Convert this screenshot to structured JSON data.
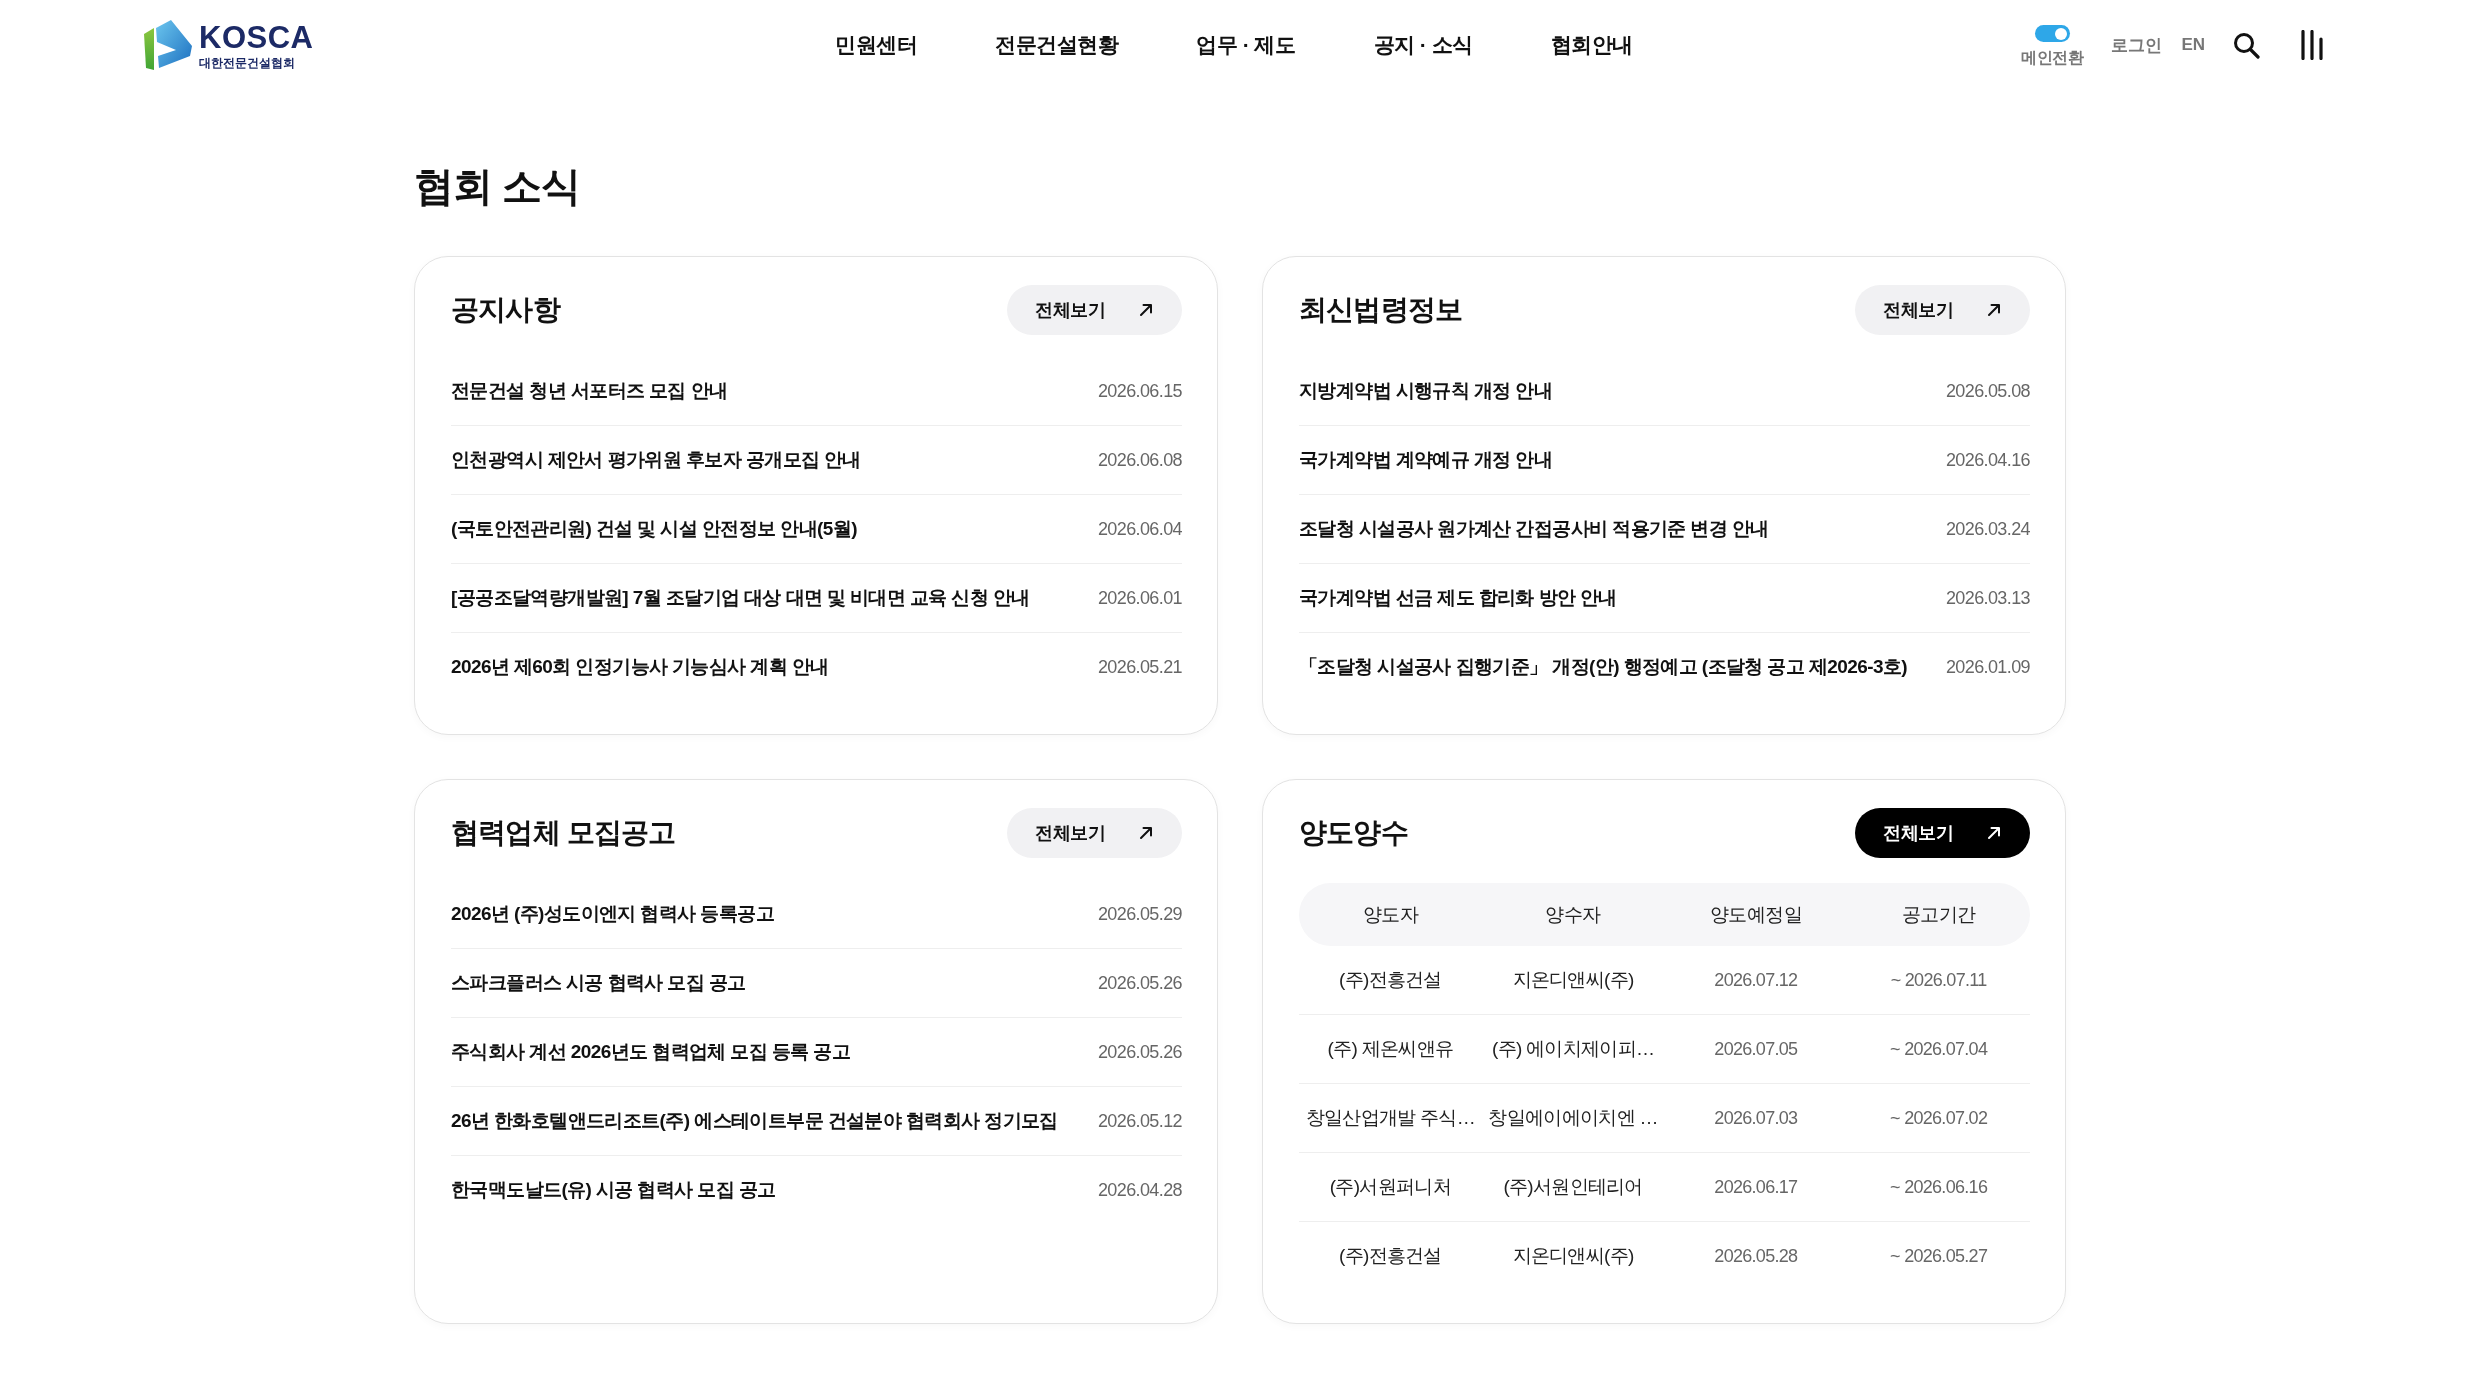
{
  "header": {
    "logo": {
      "name": "KOSCA",
      "subtitle": "대한전문건설협회"
    },
    "nav": [
      "민원센터",
      "전문건설현황",
      "업무 · 제도",
      "공지 · 소식",
      "협회안내"
    ],
    "main_switch": {
      "label": "메인전환",
      "on": true
    },
    "login": "로그인",
    "language": "EN"
  },
  "page_title": "협회 소식",
  "cards": [
    {
      "kind": "list",
      "title": "공지사항",
      "more": {
        "label": "전체보기",
        "highlighted": false
      },
      "items": [
        {
          "title": "전문건설 청년 서포터즈 모집 안내",
          "date": "2026.06.15"
        },
        {
          "title": "인천광역시 제안서 평가위원 후보자 공개모집 안내",
          "date": "2026.06.08"
        },
        {
          "title": "(국토안전관리원) 건설 및 시설 안전정보 안내(5월)",
          "date": "2026.06.04"
        },
        {
          "title": "[공공조달역량개발원] 7월 조달기업 대상 대면 및 비대면 교육 신청 안내",
          "date": "2026.06.01"
        },
        {
          "title": "2026년 제60회 인정기능사 기능심사 계획 안내",
          "date": "2026.05.21"
        }
      ]
    },
    {
      "kind": "list",
      "title": "최신법령정보",
      "more": {
        "label": "전체보기",
        "highlighted": false
      },
      "items": [
        {
          "title": "지방계약법 시행규칙 개정 안내",
          "date": "2026.05.08"
        },
        {
          "title": "국가계약법 계약예규 개정 안내",
          "date": "2026.04.16"
        },
        {
          "title": "조달청 시설공사 원가계산 간접공사비 적용기준 변경 안내",
          "date": "2026.03.24"
        },
        {
          "title": "국가계약법 선금 제도 합리화 방안 안내",
          "date": "2026.03.13"
        },
        {
          "title": "「조달청 시설공사 집행기준」 개정(안) 행정예고 (조달청 공고 제2026-3호)",
          "date": "2026.01.09"
        }
      ]
    },
    {
      "kind": "list",
      "title": "협력업체 모집공고",
      "more": {
        "label": "전체보기",
        "highlighted": false
      },
      "items": [
        {
          "title": "2026년 (주)성도이엔지 협력사 등록공고",
          "date": "2026.05.29"
        },
        {
          "title": "스파크플러스 시공 협력사 모집 공고",
          "date": "2026.05.26"
        },
        {
          "title": "주식회사 계선 2026년도 협력업체 모집 등록 공고",
          "date": "2026.05.26"
        },
        {
          "title": "26년 한화호텔앤드리조트(주) 에스테이트부문 건설분야 협력회사 정기모집",
          "date": "2026.05.12"
        },
        {
          "title": "한국맥도날드(유) 시공 협력사 모집 공고",
          "date": "2026.04.28"
        }
      ]
    },
    {
      "kind": "table",
      "title": "양도양수",
      "more": {
        "label": "전체보기",
        "highlighted": true
      },
      "columns": [
        "양도자",
        "양수자",
        "양도예정일",
        "공고기간"
      ],
      "rows": [
        [
          "(주)전흥건설",
          "지온디앤씨(주)",
          "2026.07.12",
          "~ 2026.07.11"
        ],
        [
          "(주) 제온씨앤유",
          "(주) 에이치제이피…",
          "2026.07.05",
          "~ 2026.07.04"
        ],
        [
          "창일산업개발 주식…",
          "창일에이에이치엔 …",
          "2026.07.03",
          "~ 2026.07.02"
        ],
        [
          "(주)서원퍼니처",
          "(주)서원인테리어",
          "2026.06.17",
          "~ 2026.06.16"
        ],
        [
          "(주)전흥건설",
          "지온디앤씨(주)",
          "2026.05.28",
          "~ 2026.05.27"
        ]
      ]
    }
  ]
}
